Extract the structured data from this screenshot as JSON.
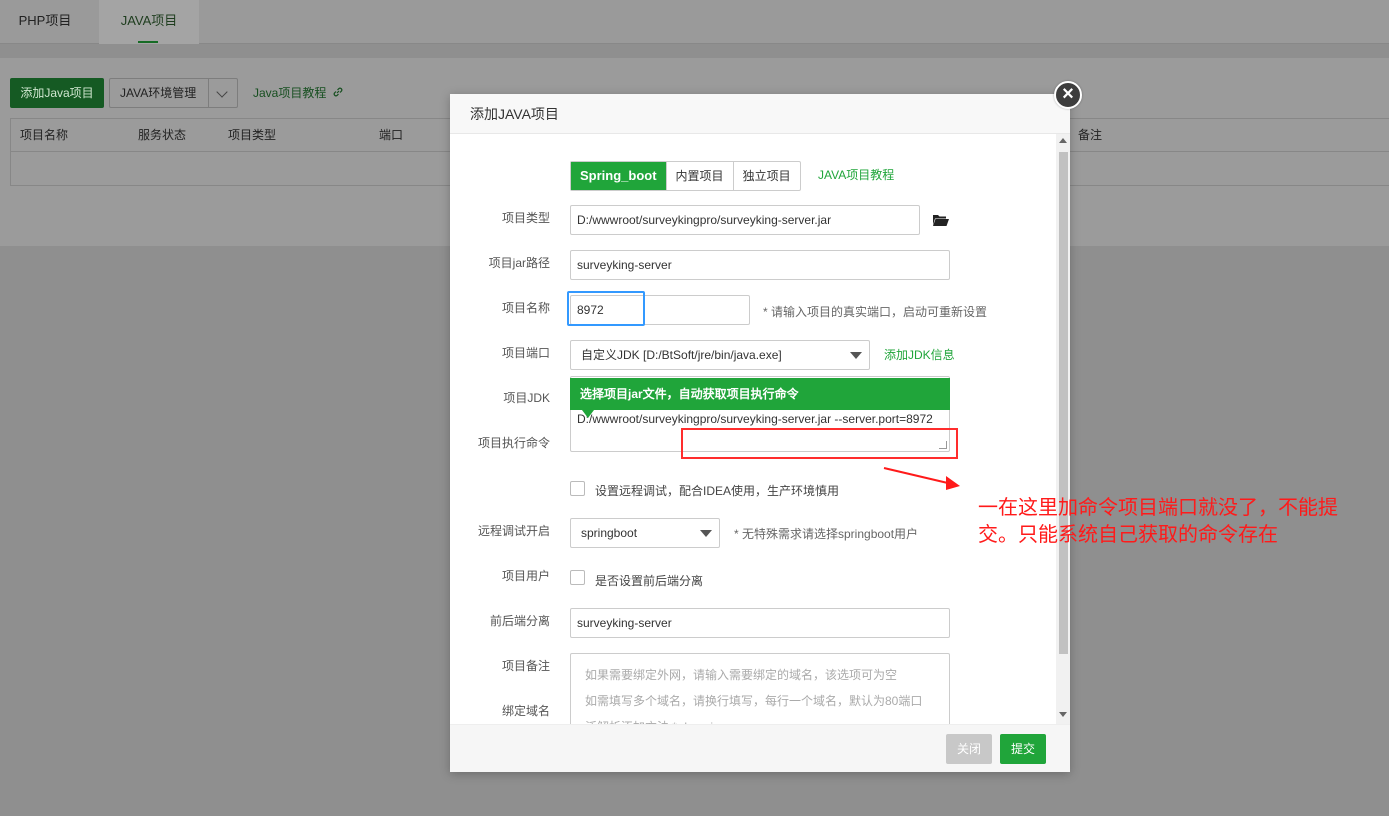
{
  "tabs": {
    "php": "PHP项目",
    "java": "JAVA项目"
  },
  "toolbar": {
    "add_java": "添加Java项目",
    "env_manage": "JAVA环境管理",
    "tutorial": "Java项目教程"
  },
  "table_headers": [
    "项目名称",
    "服务状态",
    "项目类型",
    "端口",
    "备注"
  ],
  "modal": {
    "title": "添加JAVA项目",
    "close_glyph": "×",
    "type_label": "项目类型",
    "type_options": [
      "Spring_boot",
      "内置项目",
      "独立项目"
    ],
    "type_tutorial": "JAVA项目教程",
    "jar_label": "项目jar路径",
    "jar_value": "D:/wwwroot/surveykingpro/surveyking-server.jar",
    "name_label": "项目名称",
    "name_value": "surveyking-server",
    "port_label": "项目端口",
    "port_value": "8972",
    "port_hint": "* 请输入项目的真实端口，启动可重新设置",
    "jdk_label": "项目JDK",
    "jdk_value": "自定义JDK [D:/BtSoft/jre/bin/java.exe]",
    "jdk_add": "添加JDK信息",
    "cmd_label": "项目执行命令",
    "cmd_tooltip": "选择项目jar文件，自动获取项目执行命令",
    "cmd_value": "D:/wwwroot/surveykingpro/surveyking-server.jar --server.port=8972",
    "debug_label": "远程调试开启",
    "debug_text": "设置远程调试，配合IDEA使用，生产环境慎用",
    "user_label": "项目用户",
    "user_value": "springboot",
    "user_hint": "* 无特殊需求请选择springboot用户",
    "sep_label": "前后端分离",
    "sep_text": "是否设置前后端分离",
    "remark_label": "项目备注",
    "remark_value": "surveyking-server",
    "domain_label": "绑定域名",
    "domain_placeholder_1": "如果需要绑定外网，请输入需要绑定的域名，该选项可为空",
    "domain_placeholder_2": "如需填写多个域名，请换行填写，每行一个域名，默认为80端口",
    "domain_placeholder_3": "泛解析添加方法 *.domain.com",
    "btn_close": "关闭",
    "btn_submit": "提交"
  },
  "annotation": {
    "text": "一在这里加命令项目端口就没了，不能提交。只能系统自己获取的命令存在"
  },
  "colors": {
    "accent": "#20a53a",
    "annotation_red": "#ff1a1a",
    "highlight_blue": "#3399ff"
  }
}
